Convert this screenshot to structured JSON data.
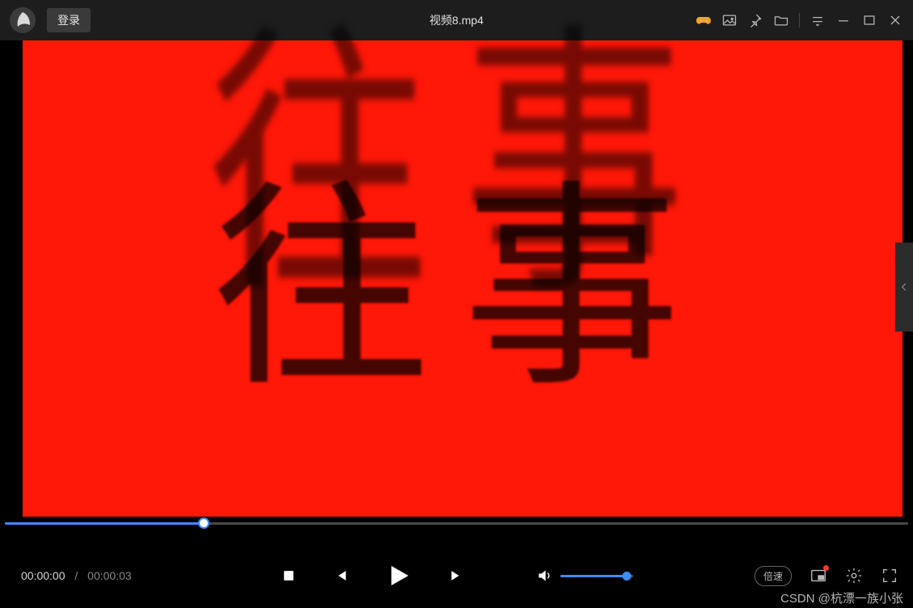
{
  "header": {
    "login_label": "登录",
    "title": "视频8.mp4"
  },
  "video": {
    "overlay_text": "往事"
  },
  "progress": {
    "percent": 22
  },
  "playback": {
    "current_time": "00:00:00",
    "separator": "/",
    "duration": "00:00:03"
  },
  "volume": {
    "percent": 92
  },
  "controls": {
    "speed_label": "倍速"
  },
  "watermark": "CSDN @杭漂一族小张"
}
